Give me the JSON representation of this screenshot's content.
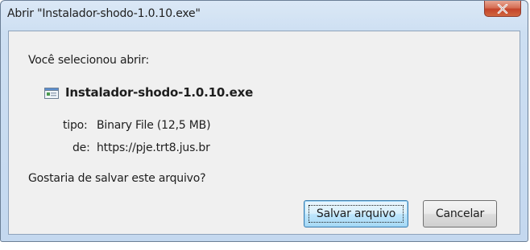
{
  "window": {
    "title": "Abrir \"Instalador-shodo-1.0.10.exe\"",
    "close_icon": "close-icon"
  },
  "dialog": {
    "intro": "Você selecionou abrir:",
    "file_icon": "executable-file-icon",
    "filename": "Instalador-shodo-1.0.10.exe",
    "type_label": "tipo:",
    "type_value": "Binary File (12,5 MB)",
    "from_label": "de:",
    "from_value": "https://pje.trt8.jus.br",
    "question": "Gostaria de salvar este arquivo?"
  },
  "buttons": {
    "save": "Salvar arquivo",
    "cancel": "Cancelar"
  },
  "colors": {
    "title_bar": "#cddff2",
    "close_button": "#c4442a",
    "content_bg": "#f0f0f0",
    "default_button_border": "#3c7fb1"
  }
}
